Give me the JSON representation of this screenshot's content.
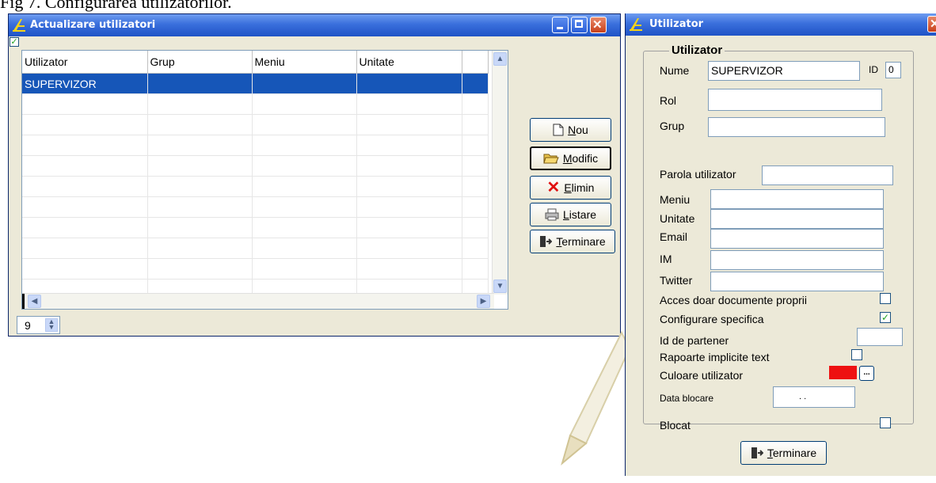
{
  "caption": "Fig 7. Configurarea utilizatorilor.",
  "list_window": {
    "title": "Actualizare utilizatori",
    "columns": [
      "Utilizator",
      "Grup",
      "Meniu",
      "Unitate"
    ],
    "rows": [
      [
        "SUPERVIZOR",
        "",
        "",
        ""
      ],
      [
        "",
        "",
        "",
        ""
      ],
      [
        "",
        "",
        "",
        ""
      ],
      [
        "",
        "",
        "",
        ""
      ],
      [
        "",
        "",
        "",
        ""
      ],
      [
        "",
        "",
        "",
        ""
      ],
      [
        "",
        "",
        "",
        ""
      ],
      [
        "",
        "",
        "",
        ""
      ],
      [
        "",
        "",
        "",
        ""
      ],
      [
        "",
        "",
        "",
        ""
      ],
      [
        "",
        "",
        "",
        ""
      ]
    ],
    "selected_row": 0,
    "record_count": "9",
    "buttons": {
      "nou_u": "N",
      "nou_rest": "ou",
      "modific_u": "M",
      "modific_rest": "odific",
      "elimin_u": "E",
      "elimin_rest": "limin",
      "listare_u": "L",
      "listare_rest": "istare",
      "terminare_u": "T",
      "terminare_rest": "erminare"
    }
  },
  "user_window": {
    "title": "Utilizator",
    "group_label": "Utilizator",
    "labels": {
      "nume": "Nume",
      "id": "ID",
      "rol": "Rol",
      "grup": "Grup",
      "parola": "Parola utilizator",
      "meniu": "Meniu",
      "unitate": "Unitate",
      "email": "Email",
      "im": "IM",
      "twitter": "Twitter",
      "acces": "Acces doar documente proprii",
      "configurare": "Configurare  specifica",
      "partener": "Id de partener",
      "rapoarte": "Rapoarte implicite text",
      "culoare": "Culoare utilizator",
      "data_blocare": "Data blocare",
      "blocat": "Blocat"
    },
    "values": {
      "nume": "SUPERVIZOR",
      "id": "0",
      "data_blocare": " .  .",
      "acces_checked": false,
      "configurare_checked": true,
      "rapoarte_checked": false,
      "blocat_checked": false,
      "culoare": "#ee1111"
    },
    "terminare_u": "T",
    "terminare_rest": "erminare"
  }
}
